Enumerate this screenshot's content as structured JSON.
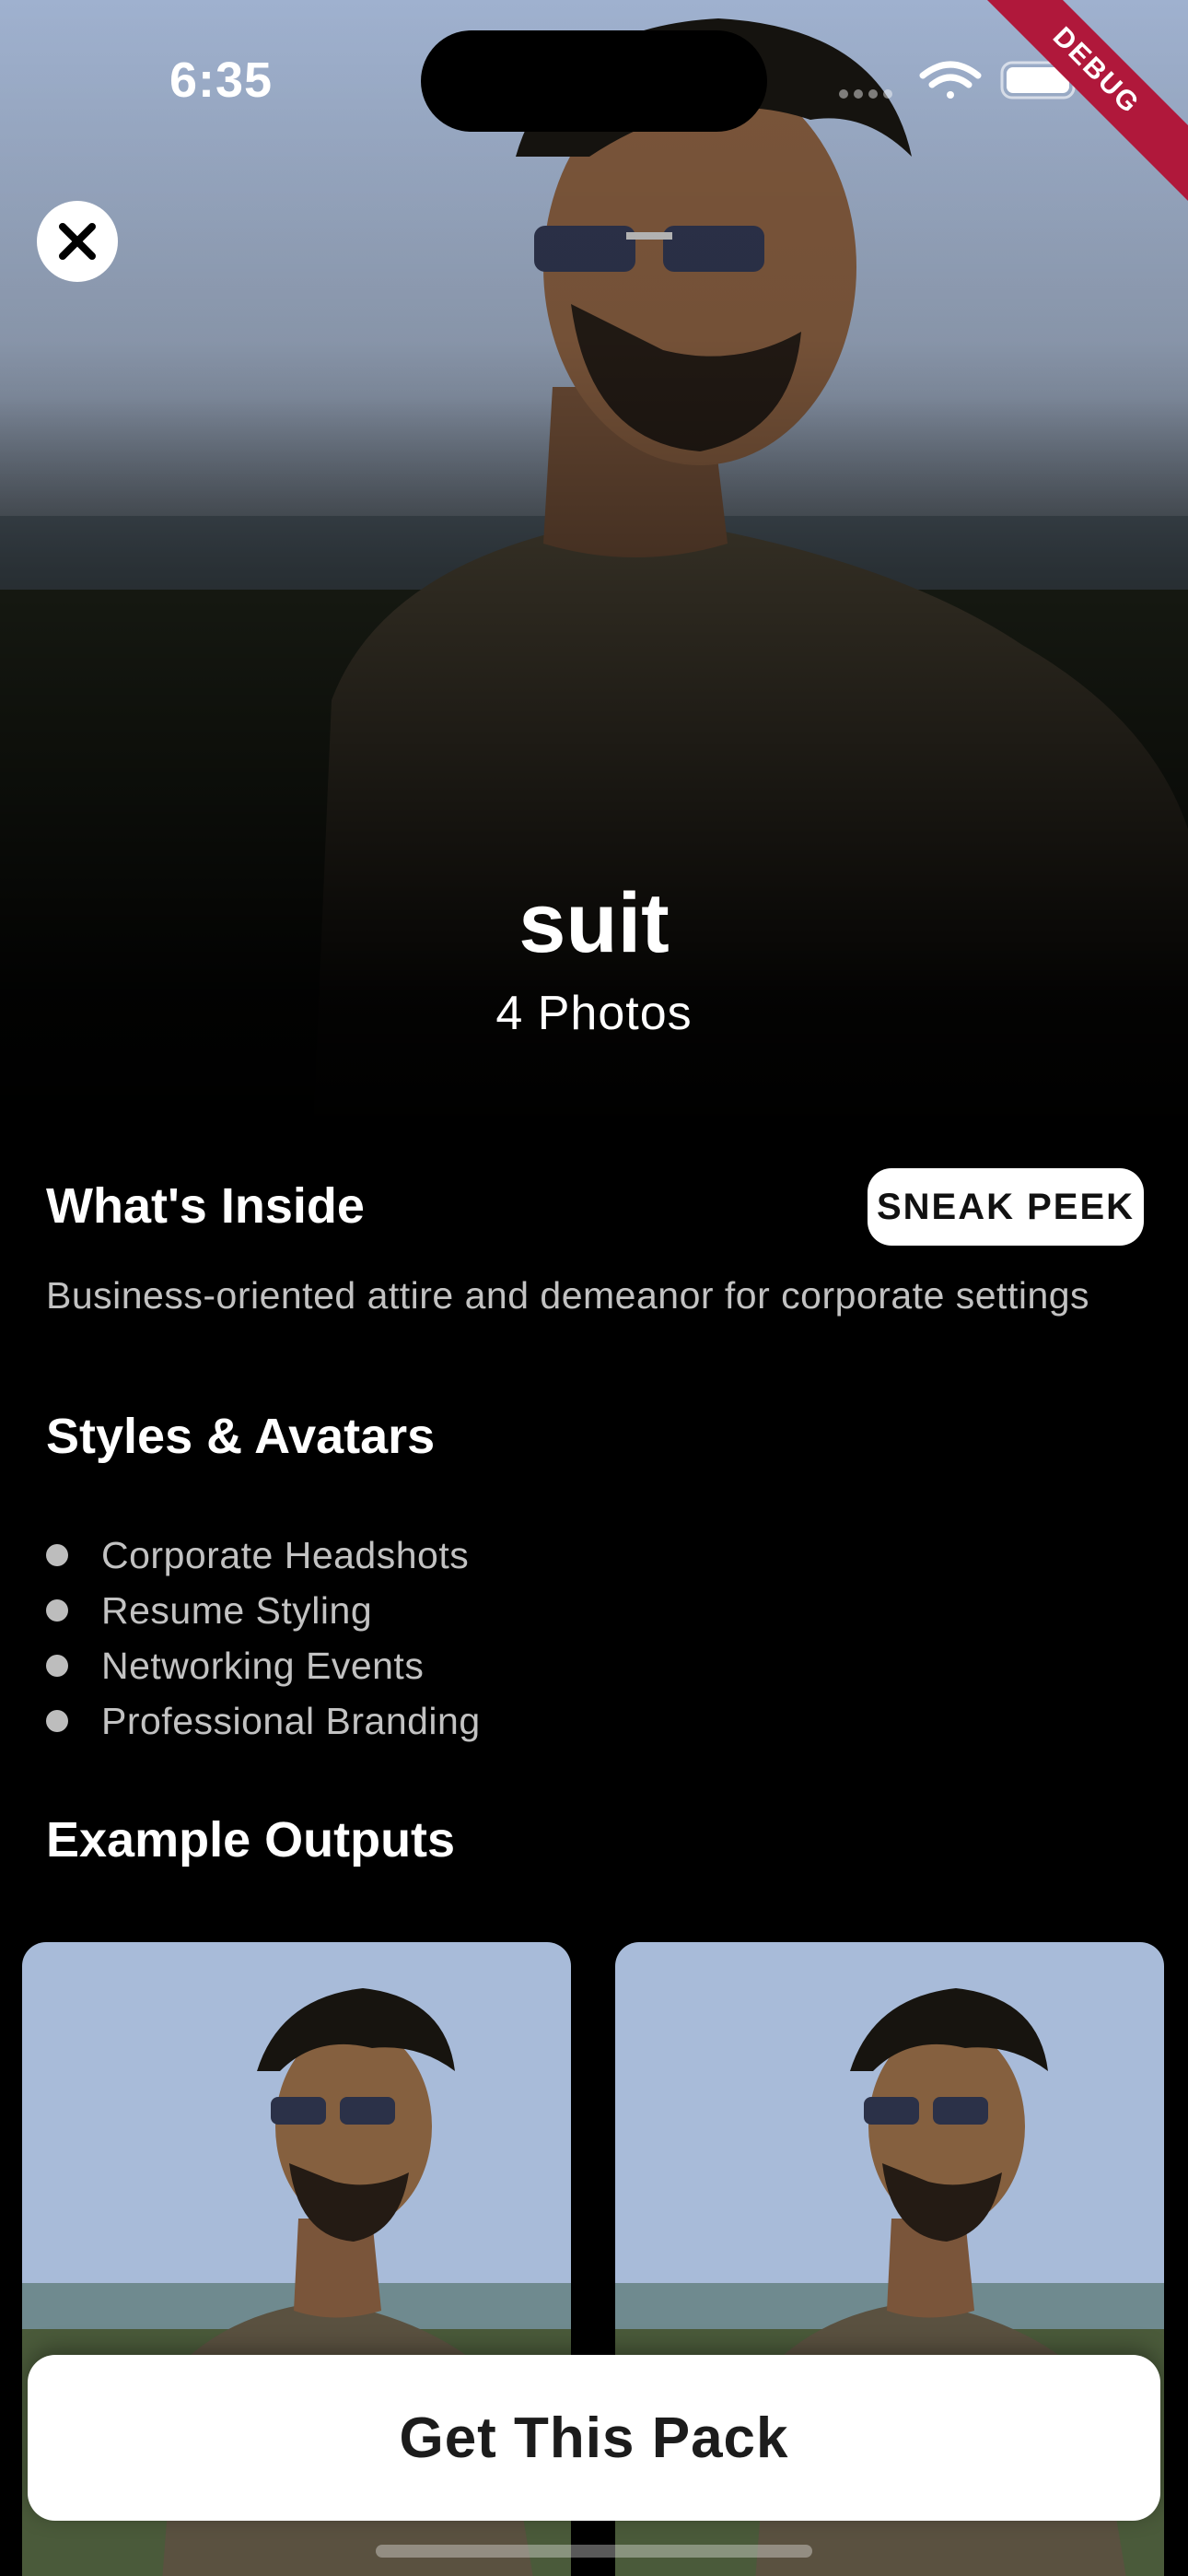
{
  "status_bar": {
    "time": "6:35",
    "debug_label": "DEBUG"
  },
  "hero": {
    "title": "suit",
    "subtitle": "4 Photos"
  },
  "whats_inside": {
    "heading": "What's Inside",
    "sneak_peek_label": "SNEAK PEEK",
    "description": "Business-oriented attire and demeanor for corporate settings"
  },
  "styles": {
    "heading": "Styles & Avatars",
    "items": [
      "Corporate Headshots",
      "Resume Styling",
      "Networking Events",
      "Professional Branding"
    ]
  },
  "examples": {
    "heading": "Example Outputs"
  },
  "cta": {
    "label": "Get This Pack"
  },
  "icons": [
    "close-icon",
    "wifi-icon",
    "battery-icon",
    "cellular-icon"
  ]
}
